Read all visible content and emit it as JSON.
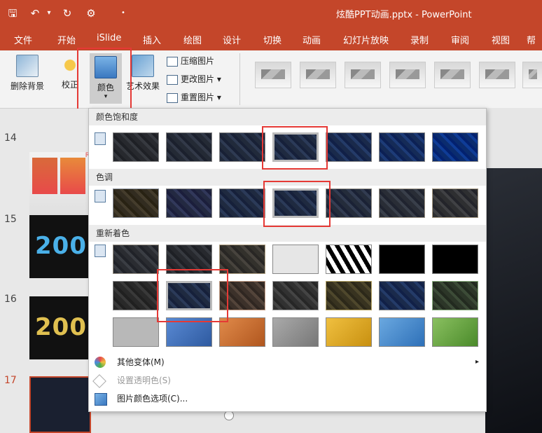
{
  "app": {
    "title": "炫酷PPT动画.pptx - PowerPoint",
    "accent_color": "#c4462a"
  },
  "quick_access": {
    "icons": [
      "save-icon",
      "undo-icon",
      "redo-icon",
      "customize-icon"
    ],
    "dropdown_glyph": "▾"
  },
  "menu": {
    "tabs": [
      "文件",
      "开始",
      "iSlide",
      "插入",
      "绘图",
      "设计",
      "切换",
      "动画",
      "幻灯片放映",
      "录制",
      "审阅",
      "视图",
      "帮"
    ]
  },
  "ribbon": {
    "remove_background": "删除背景",
    "corrections": "校正",
    "color": "颜色",
    "artistic_effects": "艺术效果",
    "compress": "压缩图片",
    "change_picture": "更改图片",
    "reset_picture": "重置图片"
  },
  "slides": {
    "numbers": [
      "14",
      "15",
      "16",
      "17"
    ],
    "badge_14": "R",
    "text_15": "200",
    "text_16": "200"
  },
  "dropdown": {
    "sections": {
      "saturation": "颜色饱和度",
      "tone": "色调",
      "recolor": "重新着色"
    },
    "items": {
      "more_variations": "其他变体(M)",
      "set_transparent": "设置透明色(S)",
      "color_options": "图片颜色选项(C)..."
    },
    "submenu_arrow": "▸",
    "recolor_colors_row3": [
      "#9aa0a6",
      "#3d6fb6",
      "#c8662a",
      "#8c8c8c",
      "#d9a82a",
      "#4a86c8",
      "#6a9a3a"
    ],
    "recolor_colors_row2": [
      "#22262c",
      "#2e4a8a",
      "#5a3a2a",
      "#3a3a3a",
      "#5a4a1a",
      "#1e3a5a",
      "#2a4a2a"
    ]
  }
}
